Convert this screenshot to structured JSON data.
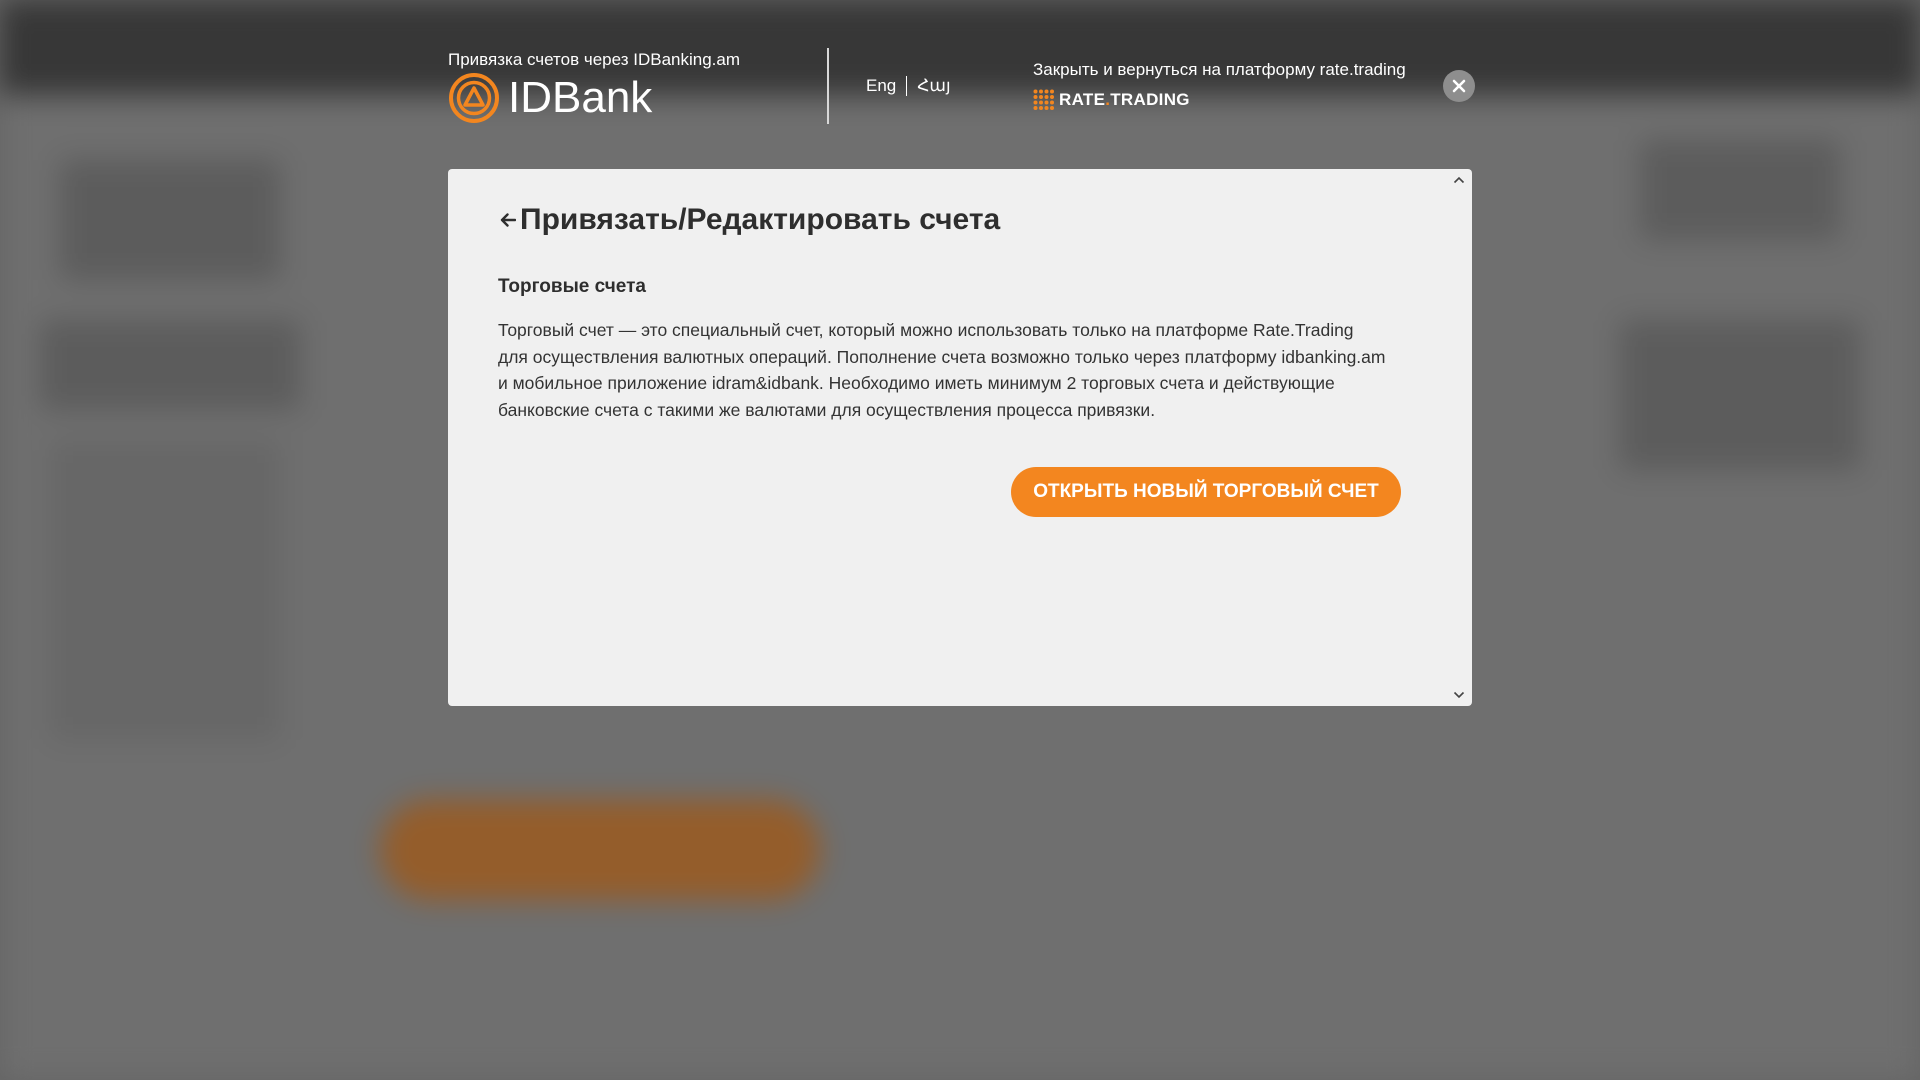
{
  "header": {
    "bank_caption": "Привязка счетов через IDBanking.am",
    "bank_logo_text": "IDBank",
    "languages": [
      "Eng",
      "Հայ"
    ],
    "close_caption": "Закрыть и вернуться на платформу rate.trading",
    "rate_logo_left": "RATE",
    "rate_logo_dot": ".",
    "rate_logo_right": "TRADING"
  },
  "modal": {
    "title": "Привязать/Редактировать счета",
    "section_title": "Торговые счета",
    "description": "Торговый счет — это специальный счет, который можно использовать только на платформе Rate.Trading для осуществления валютных операций. Пополнение счета возможно только через платформу idbanking.am и мобильное приложение idram&idbank. Необходимо иметь минимум 2 торговых счета и действующие банковские счета с такими же валютами для осуществления процесса привязки.",
    "open_account_label": "ОТКРЫТЬ НОВЫЙ ТОРГОВЫЙ СЧЕТ"
  },
  "colors": {
    "accent": "#f3861f",
    "modal_bg": "#f0f0f0",
    "text_dark": "#2e2e2e"
  },
  "icons": {
    "bank_logo": "idbank-logo-icon",
    "rate_logo": "rate-trading-grid-icon",
    "close": "close-icon",
    "back": "arrow-left-icon",
    "scroll_up": "chevron-up-icon",
    "scroll_down": "chevron-down-icon"
  }
}
